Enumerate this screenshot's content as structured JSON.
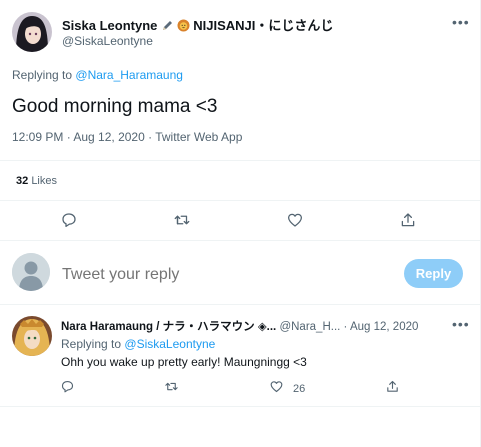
{
  "main_tweet": {
    "display_name": "Siska Leontyne",
    "name_suffix": "NIJISANJI・にじさんじ",
    "handle": "@SiskaLeontyne",
    "replying_prefix": "Replying to",
    "replying_to": "@Nara_Haramaung",
    "text": "Good morning mama <3",
    "meta": "12:09 PM · Aug 12, 2020 · Twitter Web App",
    "like_count": "32",
    "like_label": "Likes",
    "more_icon": "more-horizontal-icon"
  },
  "composer": {
    "placeholder": "Tweet your reply",
    "button_label": "Reply"
  },
  "reply_tweet": {
    "display_name": "Nara Haramaung / ナラ・ハラマウン ◈...",
    "handle": "@Nara_H...",
    "separator": "·",
    "date": "Aug 12, 2020",
    "replying_prefix": "Replying to",
    "replying_to": "@SiskaLeontyne",
    "text": "Ohh you wake up pretty early! Maungningg <3",
    "like_count": "26"
  },
  "colors": {
    "accent": "#1d9bf0",
    "reply_button_disabled": "#8ecdf8",
    "muted_text": "#536471",
    "divider": "#eff3f4"
  }
}
